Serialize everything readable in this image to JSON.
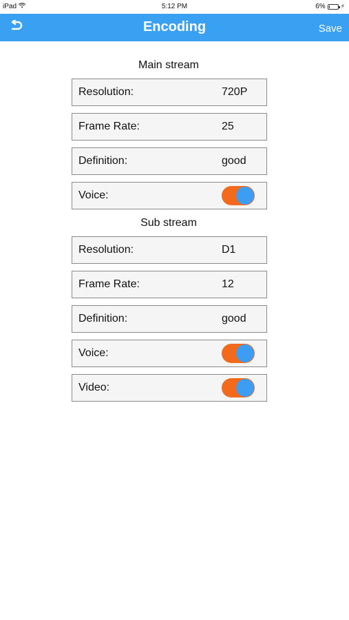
{
  "status_bar": {
    "device": "iPad",
    "time": "5:12 PM",
    "battery": "6%"
  },
  "nav": {
    "title": "Encoding",
    "save_label": "Save"
  },
  "main_stream": {
    "title": "Main stream",
    "resolution_label": "Resolution:",
    "resolution_value": "720P",
    "frame_rate_label": "Frame Rate:",
    "frame_rate_value": "25",
    "definition_label": "Definition:",
    "definition_value": "good",
    "voice_label": "Voice:",
    "voice_on": true
  },
  "sub_stream": {
    "title": "Sub stream",
    "resolution_label": "Resolution:",
    "resolution_value": "D1",
    "frame_rate_label": "Frame Rate:",
    "frame_rate_value": "12",
    "definition_label": "Definition:",
    "definition_value": "good",
    "voice_label": "Voice:",
    "voice_on": true,
    "video_label": "Video:",
    "video_on": true
  },
  "colors": {
    "nav_background": "#3aa1f2",
    "toggle_track": "#f36a1c",
    "toggle_knob": "#3d9df2",
    "row_background": "#f5f5f5",
    "row_border": "#8a8a8a"
  },
  "icons": {
    "back": "undo-arrow-icon",
    "wifi": "wifi-icon",
    "battery": "battery-icon",
    "charging": "charging-bolt-icon"
  }
}
